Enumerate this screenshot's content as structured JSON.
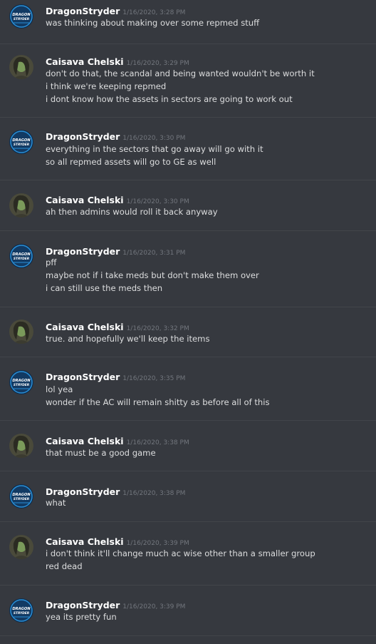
{
  "colors": {
    "background": "#36393f",
    "author": "#ffffff",
    "timestamp": "#72767d",
    "text": "#dcddde",
    "divider": "#42454a"
  },
  "users": {
    "dragon": {
      "name": "DragonStryder",
      "avatar_text_1": "DRAGON",
      "avatar_text_2": "STRYDER",
      "avatar_icon": "dragon-logo-icon"
    },
    "caisava": {
      "name": "Caisava Chelski",
      "avatar_icon": "character-portrait-icon"
    }
  },
  "messages": [
    {
      "author": "DragonStryder",
      "time": "1/16/2020, 3:28 PM",
      "lines": [
        "was thinking about making over some repmed stuff"
      ]
    },
    {
      "author": "Caisava Chelski",
      "time": "1/16/2020, 3:29 PM",
      "lines": [
        "don't do that, the scandal and being wanted wouldn't be worth it",
        "i think we're keeping repmed",
        "i dont know how the assets in sectors are going to work out"
      ]
    },
    {
      "author": "DragonStryder",
      "time": "1/16/2020, 3:30 PM",
      "lines": [
        "everything in the sectors that go away will go with it",
        "so all repmed assets will go to GE as well"
      ]
    },
    {
      "author": "Caisava Chelski",
      "time": "1/16/2020, 3:30 PM",
      "lines": [
        "ah then admins would roll it back anyway"
      ]
    },
    {
      "author": "DragonStryder",
      "time": "1/16/2020, 3:31 PM",
      "lines": [
        "pff",
        "maybe not if i take meds but don't make them over",
        "i can still use the meds then"
      ]
    },
    {
      "author": "Caisava Chelski",
      "time": "1/16/2020, 3:32 PM",
      "lines": [
        "true. and hopefully we'll keep the items"
      ]
    },
    {
      "author": "DragonStryder",
      "time": "1/16/2020, 3:35 PM",
      "lines": [
        "lol yea",
        "wonder if the AC will remain shitty as before all of this"
      ]
    },
    {
      "author": "Caisava Chelski",
      "time": "1/16/2020, 3:38 PM",
      "lines": [
        "that must be a good game"
      ]
    },
    {
      "author": "DragonStryder",
      "time": "1/16/2020, 3:38 PM",
      "lines": [
        "what"
      ]
    },
    {
      "author": "Caisava Chelski",
      "time": "1/16/2020, 3:39 PM",
      "lines": [
        "i don't think it'll change much ac wise other than a smaller group",
        "red dead"
      ]
    },
    {
      "author": "DragonStryder",
      "time": "1/16/2020, 3:39 PM",
      "lines": [
        "yea its pretty fun"
      ]
    }
  ]
}
